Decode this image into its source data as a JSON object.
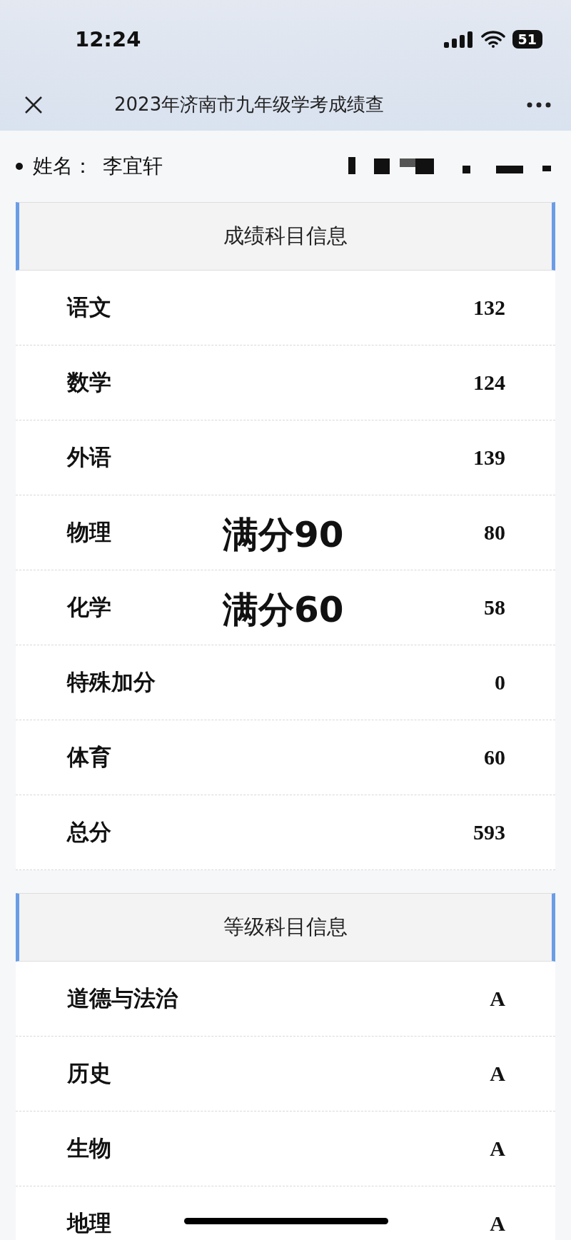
{
  "status_bar": {
    "time": "12:24",
    "battery": "51"
  },
  "nav": {
    "title": "2023年济南市九年级学考成绩查"
  },
  "student": {
    "label": "姓名：",
    "name": "李宜轩"
  },
  "sections": [
    {
      "title": "成绩科目信息",
      "rows": [
        {
          "subject": "语文",
          "value": "132"
        },
        {
          "subject": "数学",
          "value": "124"
        },
        {
          "subject": "外语",
          "value": "139"
        },
        {
          "subject": "物理",
          "value": "80",
          "annotation": "满分90"
        },
        {
          "subject": "化学",
          "value": "58",
          "annotation": "满分60"
        },
        {
          "subject": "特殊加分",
          "value": "0"
        },
        {
          "subject": "体育",
          "value": "60"
        },
        {
          "subject": "总分",
          "value": "593"
        }
      ]
    },
    {
      "title": "等级科目信息",
      "rows": [
        {
          "subject": "道德与法治",
          "value": "A"
        },
        {
          "subject": "历史",
          "value": "A"
        },
        {
          "subject": "生物",
          "value": "A"
        },
        {
          "subject": "地理",
          "value": "A"
        }
      ]
    }
  ]
}
